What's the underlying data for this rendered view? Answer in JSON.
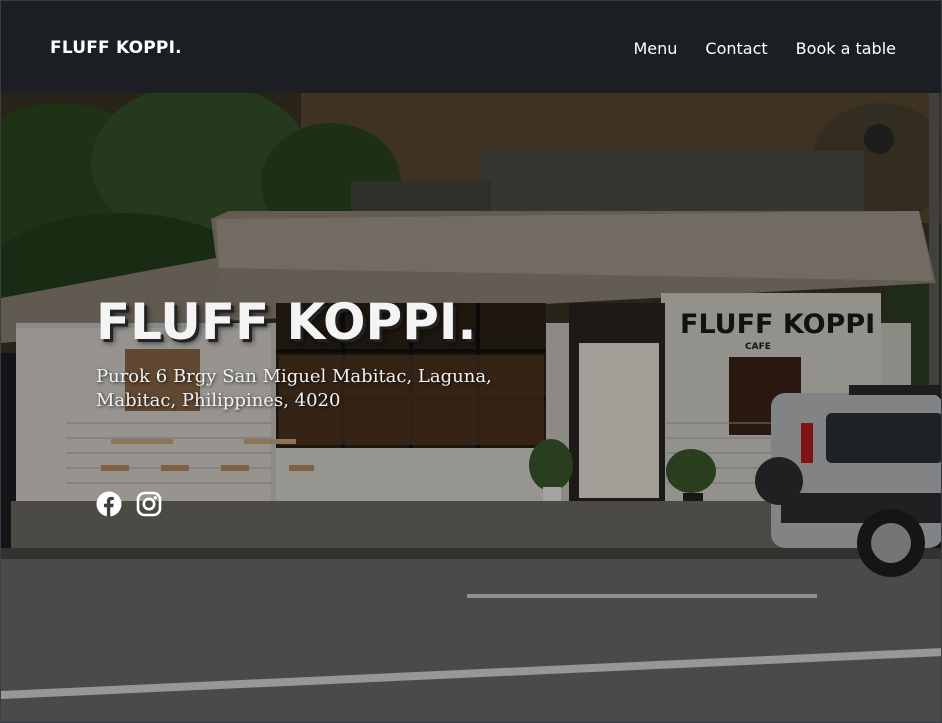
{
  "navbar": {
    "brand": "FLUFF KOPPI.",
    "links": [
      {
        "label": "Menu",
        "icon": ""
      },
      {
        "label": "Contact",
        "icon": ""
      },
      {
        "label": "Book a table",
        "icon": ""
      }
    ]
  },
  "hero": {
    "title": "FLUFF KOPPI.",
    "address_line1": "Purok 6 Brgy San Miguel Mabitac, Laguna,",
    "address_line2": "Mabitac, Philippines, 4020",
    "storefront_sign": "FLUFF KOPPI",
    "storefront_sign_sub": "CAFE",
    "social": [
      {
        "icon": "facebook-icon"
      },
      {
        "icon": "instagram-icon"
      }
    ]
  },
  "colors": {
    "navbar_bg": "#1b1e22",
    "text": "#ffffff"
  }
}
